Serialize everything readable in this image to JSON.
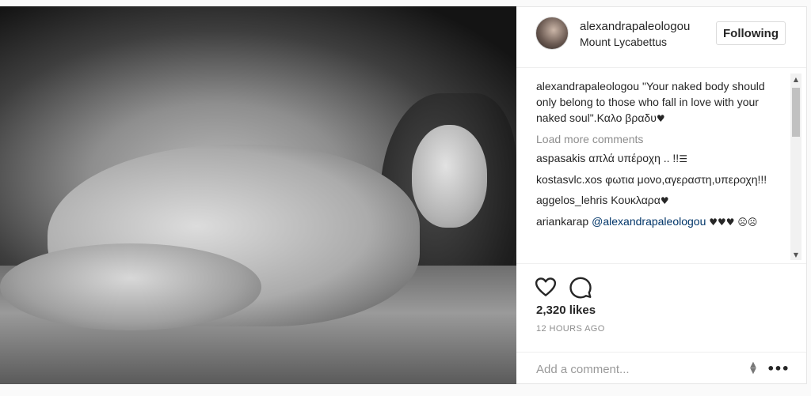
{
  "post": {
    "image_alt": "",
    "colors": {
      "text": "#262626",
      "muted": "#8e8e8e",
      "border": "#efefef"
    }
  },
  "header": {
    "username": "alexandrapaleologou",
    "location": "Mount Lycabettus",
    "follow_label": "Following"
  },
  "caption": {
    "user": "alexandrapaleologou",
    "text": "\"Your naked body should only belong to those who fall in love with your naked soul\".Καλο βραδυ",
    "emoji": "♥"
  },
  "load_more_label": "Load more comments",
  "comments": [
    {
      "user": "aspasakis",
      "text": "απλά υπέροχη .. !!",
      "emoji": "☰"
    },
    {
      "user": "kostasvlc.xos",
      "text": "φωτια μονο,αγεραστη,υπεροχη!!!",
      "emoji": ""
    },
    {
      "user": "aggelos_lehris",
      "text": "Κουκλαρα",
      "emoji": "♥"
    },
    {
      "user": "ariankarap",
      "text": "@alexandrapaleologou",
      "emoji": "♥♥♥ ☹☹"
    }
  ],
  "actions": {
    "heart_icon": "heart-icon",
    "comment_icon": "comment-icon",
    "likes": "2,320 likes",
    "timestamp": "12 HOURS AGO"
  },
  "add_comment": {
    "placeholder": "Add a comment...",
    "more_label": "•••"
  }
}
